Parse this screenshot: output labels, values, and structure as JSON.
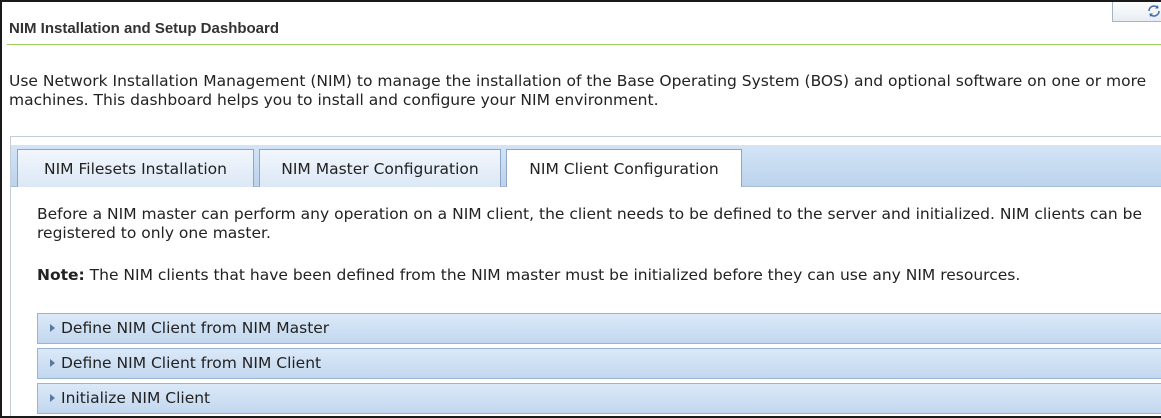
{
  "header": {
    "title": "NIM Installation and Setup Dashboard",
    "refresh_icon": "refresh-icon"
  },
  "intro": {
    "text": "Use Network Installation Management (NIM) to manage the installation of the Base Operating System (BOS) and optional software on one or more machines. This dashboard helps you to install and configure your NIM environment."
  },
  "tabs": [
    {
      "label": "NIM Filesets Installation",
      "active": false
    },
    {
      "label": "NIM Master Configuration",
      "active": false
    },
    {
      "label": "NIM Client Configuration",
      "active": true
    }
  ],
  "content": {
    "paragraph": "Before a NIM master can perform any operation on a NIM client, the client needs to be defined to the server and initialized. NIM clients can be registered to only one master.",
    "note_label": "Note:",
    "note_text": " The NIM clients that have been defined from the NIM master must be initialized before they can use any NIM resources.",
    "sections": [
      {
        "label": "Define NIM Client from NIM Master",
        "expanded": false
      },
      {
        "label": "Define NIM Client from NIM Client",
        "expanded": false
      },
      {
        "label": "Initialize NIM Client",
        "expanded": false
      }
    ]
  },
  "colors": {
    "title_rule": "#9ccf5c",
    "tab_bar": "#c8dcf2",
    "section_header": "#cfe0f4"
  }
}
